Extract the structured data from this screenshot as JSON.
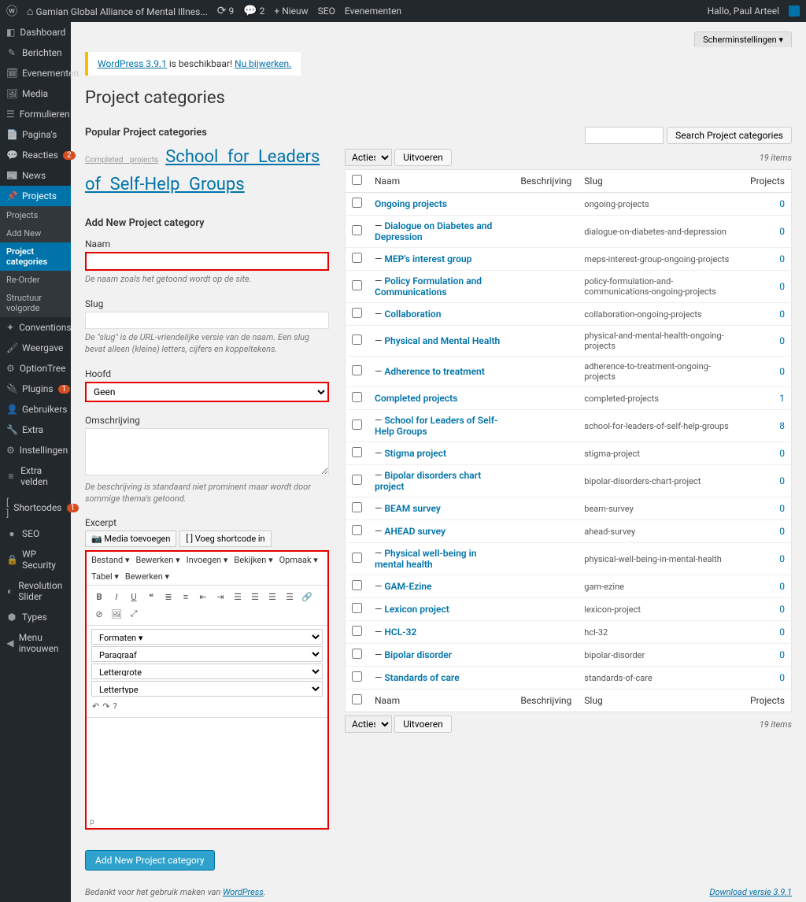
{
  "toolbar": {
    "site_name": "Gamian Global Alliance of Mental Illnes...",
    "updates": "9",
    "comments": "2",
    "new": "+ Nieuw",
    "seo": "SEO",
    "events": "Evenementen",
    "greeting": "Hallo, Paul Arteel"
  },
  "screen_options": "Scherminstellingen ▾",
  "update_nag": {
    "lead": "WordPress 3.9.1",
    "mid": " is beschikbaar! ",
    "link": "Nu bijwerken."
  },
  "page_title": "Project categories",
  "admin_menu": [
    {
      "icon": "◧",
      "label": "Dashboard"
    },
    {
      "icon": "✎",
      "label": "Berichten"
    },
    {
      "icon": "🗓",
      "label": "Evenementen"
    },
    {
      "icon": "🖼",
      "label": "Media"
    },
    {
      "icon": "☰",
      "label": "Formulieren"
    },
    {
      "icon": "📄",
      "label": "Pagina's"
    },
    {
      "icon": "💬",
      "label": "Reacties",
      "badge": "2"
    },
    {
      "icon": "📰",
      "label": "News"
    },
    {
      "icon": "📌",
      "label": "Projects",
      "open": true,
      "submenu": [
        "Projects",
        "Add New",
        "Project categories",
        "Re-Order",
        "Structuur volgorde"
      ],
      "current": "Project categories"
    },
    {
      "icon": "✦",
      "label": "Conventions"
    },
    {
      "icon": "🖌",
      "label": "Weergave"
    },
    {
      "icon": "⚙",
      "label": "OptionTree"
    },
    {
      "icon": "🔌",
      "label": "Plugins",
      "badge": "1"
    },
    {
      "icon": "👤",
      "label": "Gebruikers"
    },
    {
      "icon": "🔧",
      "label": "Extra"
    },
    {
      "icon": "⚙",
      "label": "Instellingen"
    },
    {
      "icon": "≡",
      "label": "Extra velden"
    },
    {
      "icon": "[ ]",
      "label": "Shortcodes",
      "badge": "1"
    },
    {
      "icon": "●",
      "label": "SEO"
    },
    {
      "icon": "🔒",
      "label": "WP Security"
    },
    {
      "icon": "◐",
      "label": "Revolution Slider"
    },
    {
      "icon": "⬢",
      "label": "Types"
    },
    {
      "icon": "◀",
      "label": "Menu invouwen"
    }
  ],
  "popular": {
    "heading": "Popular Project categories",
    "small": "Completed projects",
    "big": "School for Leaders of Self-Help Groups"
  },
  "form": {
    "heading": "Add New Project category",
    "name_label": "Naam",
    "name_desc": "De naam zoals het getoond wordt op de site.",
    "slug_label": "Slug",
    "slug_desc": "De \"slug\" is de URL-vriendelijke versie van de naam. Een slug bevat alleen (kleine) letters, cijfers en koppeltekens.",
    "parent_label": "Hoofd",
    "parent_value": "Geen",
    "desc_label": "Omschrijving",
    "desc_desc": "De beschrijving is standaard niet prominent maar wordt door sommige thema's getoond.",
    "excerpt_label": "Excerpt",
    "add_media": "📷 Media toevoegen",
    "add_shortcode": "[ ] Voeg shortcode in",
    "tinymce_menus": [
      "Bestand ▾",
      "Bewerken ▾",
      "Invoegen ▾",
      "Bekijken ▾",
      "Opmaak ▾",
      "Tabel ▾",
      "Bewerken ▾"
    ],
    "format_sel": [
      "Formaten ▾",
      "Paragraaf",
      "Lettergrote",
      "Lettertype"
    ],
    "submit": "Add New Project category"
  },
  "search": {
    "button": "Search Project categories"
  },
  "bulk": {
    "label": "Acties",
    "apply": "Uitvoeren"
  },
  "items_count": "19 items",
  "columns": {
    "name": "Naam",
    "desc": "Beschrijving",
    "slug": "Slug",
    "count": "Projects"
  },
  "rows": [
    {
      "indent": 0,
      "name": "Ongoing projects",
      "slug": "ongoing-projects",
      "count": "0"
    },
    {
      "indent": 1,
      "name": "Dialogue on Diabetes and Depression",
      "slug": "dialogue-on-diabetes-and-depression",
      "count": "0"
    },
    {
      "indent": 1,
      "name": "MEP's interest group",
      "slug": "meps-interest-group-ongoing-projects",
      "count": "0"
    },
    {
      "indent": 1,
      "name": "Policy Formulation and Communications",
      "slug": "policy-formulation-and-communications-ongoing-projects",
      "count": "0"
    },
    {
      "indent": 1,
      "name": "Collaboration",
      "slug": "collaboration-ongoing-projects",
      "count": "0"
    },
    {
      "indent": 1,
      "name": "Physical and Mental Health",
      "slug": "physical-and-mental-health-ongoing-projects",
      "count": "0"
    },
    {
      "indent": 1,
      "name": "Adherence to treatment",
      "slug": "adherence-to-treatment-ongoing-projects",
      "count": "0"
    },
    {
      "indent": 0,
      "name": "Completed projects",
      "slug": "completed-projects",
      "count": "1"
    },
    {
      "indent": 1,
      "name": "School for Leaders of Self-Help Groups",
      "slug": "school-for-leaders-of-self-help-groups",
      "count": "8"
    },
    {
      "indent": 1,
      "name": "Stigma project",
      "slug": "stigma-project",
      "count": "0"
    },
    {
      "indent": 1,
      "name": "Bipolar disorders chart project",
      "slug": "bipolar-disorders-chart-project",
      "count": "0"
    },
    {
      "indent": 1,
      "name": "BEAM survey",
      "slug": "beam-survey",
      "count": "0"
    },
    {
      "indent": 1,
      "name": "AHEAD survey",
      "slug": "ahead-survey",
      "count": "0"
    },
    {
      "indent": 1,
      "name": "Physical well-being in mental health",
      "slug": "physical-well-being-in-mental-health",
      "count": "0"
    },
    {
      "indent": 1,
      "name": "GAM-Ezine",
      "slug": "gam-ezine",
      "count": "0"
    },
    {
      "indent": 1,
      "name": "Lexicon project",
      "slug": "lexicon-project",
      "count": "0"
    },
    {
      "indent": 1,
      "name": "HCL-32",
      "slug": "hcl-32",
      "count": "0"
    },
    {
      "indent": 1,
      "name": "Bipolar disorder",
      "slug": "bipolar-disorder",
      "count": "0"
    },
    {
      "indent": 1,
      "name": "Standards of care",
      "slug": "standards-of-care",
      "count": "0"
    }
  ],
  "footer": {
    "thanks": "Bedankt voor het gebruik maken van ",
    "wp": "WordPress",
    "version": "Download versie 3.9.1"
  }
}
